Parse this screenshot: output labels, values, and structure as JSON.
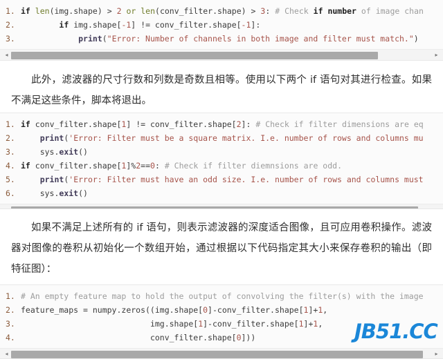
{
  "watermark": {
    "text": "JB51.CC",
    "color": "#1b87d8"
  },
  "code_blocks": [
    {
      "id": "code-block-1",
      "language": "python",
      "scrollbar": {
        "left_arrow": "◂",
        "right_arrow": "▸",
        "thumb_percent": 83
      },
      "lines": [
        {
          "num": "1.",
          "text": "if len(img.shape) > 2 or len(conv_filter.shape) > 3: # Check if number of image chan"
        },
        {
          "num": "2.",
          "text": "        if img.shape[-1] != conv_filter.shape[-1]:"
        },
        {
          "num": "3.",
          "text": "            print(\"Error: Number of channels in both image and filter must match.\")"
        }
      ]
    },
    {
      "id": "code-block-2",
      "language": "python",
      "scrollbar": {
        "left_arrow": "◂",
        "right_arrow": "▸",
        "thumb_percent": 92
      },
      "lines": [
        {
          "num": "1.",
          "text": "if conv_filter.shape[1] != conv_filter.shape[2]: # Check if filter dimensions are eq"
        },
        {
          "num": "2.",
          "text": "    print('Error: Filter must be a square matrix. I.e. number of rows and columns mu"
        },
        {
          "num": "3.",
          "text": "    sys.exit()"
        },
        {
          "num": "4.",
          "text": "if conv_filter.shape[1]%2==0: # Check if filter diemnsions are odd."
        },
        {
          "num": "5.",
          "text": "    print('Error: Filter must have an odd size. I.e. number of rows and columns must"
        },
        {
          "num": "6.",
          "text": "    sys.exit()"
        }
      ]
    },
    {
      "id": "code-block-3",
      "language": "python",
      "scrollbar": {
        "left_arrow": "◂",
        "right_arrow": "▸",
        "thumb_percent": 93
      },
      "lines": [
        {
          "num": "1.",
          "text": "# An empty feature map to hold the output of convolving the filter(s) with the image"
        },
        {
          "num": "2.",
          "text": "feature_maps = numpy.zeros((img.shape[0]-conv_filter.shape[1]+1,"
        },
        {
          "num": "3.",
          "text": "                           img.shape[1]-conv_filter.shape[1]+1,"
        },
        {
          "num": "4.",
          "text": "                           conv_filter.shape[0]))"
        }
      ]
    }
  ],
  "paragraphs": [
    {
      "id": "paragraph-1",
      "text": "此外，滤波器的尺寸行数和列数是奇数且相等。使用以下两个 if 语句对其进行检查。如果不满足这些条件，脚本将退出。"
    },
    {
      "id": "paragraph-2",
      "text": "如果不满足上述所有的 if 语句，则表示滤波器的深度适合图像，且可应用卷积操作。滤波器对图像的卷积从初始化一个数组开始，通过根据以下代码指定其大小来保存卷积的输出（即特征图）："
    }
  ]
}
